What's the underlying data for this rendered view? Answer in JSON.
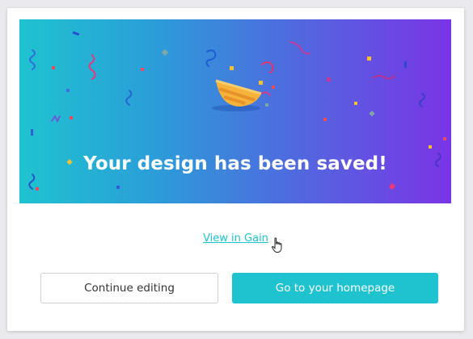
{
  "dialog": {
    "headline": "Your design has been saved!",
    "view_link": "View in Gain",
    "continue_label": "Continue editing",
    "homepage_label": "Go to your homepage"
  },
  "icons": {
    "celebration": "party-popper-icon",
    "cursor": "hand-pointer-icon"
  },
  "colors": {
    "gradient_start": "#1fc3cf",
    "gradient_end": "#7a34e6",
    "accent": "#1fc3cf",
    "popper": "#f6b23a"
  }
}
